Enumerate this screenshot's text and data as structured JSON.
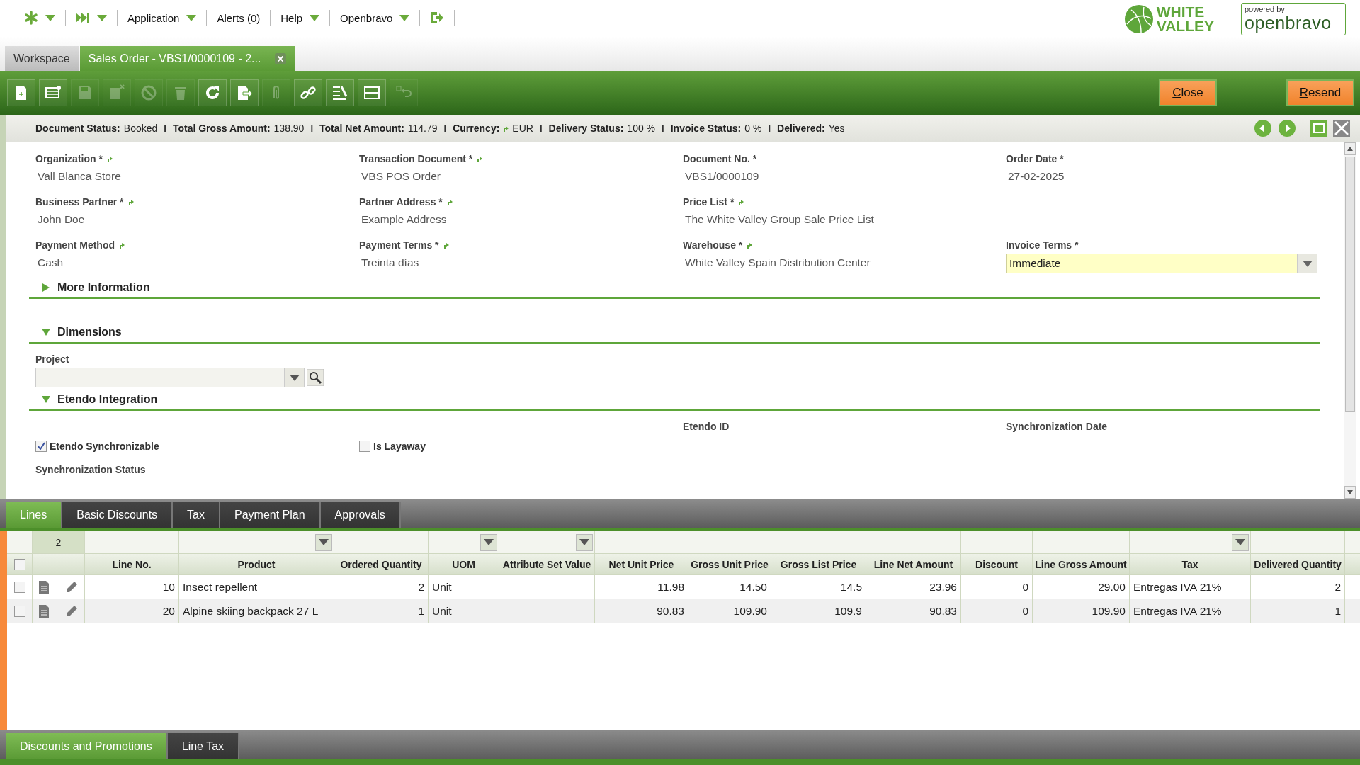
{
  "top_menu": {
    "items": [
      {
        "kind": "star",
        "dropdown": true
      },
      {
        "kind": "forward",
        "dropdown": true
      },
      {
        "kind": "text",
        "label": "Application",
        "dropdown": true
      },
      {
        "kind": "text",
        "label": "Alerts (0)",
        "dropdown": false
      },
      {
        "kind": "text",
        "label": "Help",
        "dropdown": true
      },
      {
        "kind": "text",
        "label": "Openbravo",
        "dropdown": true
      },
      {
        "kind": "logout",
        "dropdown": false
      }
    ],
    "logos": {
      "company": [
        "WHITE",
        "VALLEY"
      ],
      "powered_by": "powered by",
      "product": "openbravo"
    }
  },
  "window_tabs": [
    {
      "label": "Workspace",
      "selected": false,
      "closable": false
    },
    {
      "label": "Sales Order - VBS1/0000109 - 2...",
      "selected": true,
      "closable": true
    }
  ],
  "toolbar": {
    "buttons": [
      {
        "kind": "new",
        "disabled": false
      },
      {
        "kind": "new-grid",
        "disabled": false
      },
      {
        "kind": "save",
        "disabled": true
      },
      {
        "kind": "save-close",
        "disabled": true
      },
      {
        "kind": "cancel",
        "disabled": true
      },
      {
        "kind": "delete",
        "disabled": true
      },
      {
        "kind": "refresh",
        "disabled": false
      },
      {
        "kind": "export",
        "disabled": false
      },
      {
        "kind": "attach",
        "disabled": true
      },
      {
        "kind": "link",
        "disabled": false
      },
      {
        "kind": "tools",
        "disabled": false
      },
      {
        "kind": "layout",
        "disabled": false
      },
      {
        "kind": "undo",
        "disabled": true
      }
    ],
    "actions": [
      "Close",
      "Resend"
    ]
  },
  "status_bar": [
    {
      "label": "Document Status:",
      "value": "Booked",
      "link": false
    },
    {
      "separator": "I",
      "label": "Total Gross Amount:",
      "value": "138.90",
      "link": false
    },
    {
      "separator": "I",
      "label": "Total Net Amount:",
      "value": "114.79",
      "link": false
    },
    {
      "separator": "I",
      "label": "Currency:",
      "value": "EUR",
      "link": true
    },
    {
      "separator": "I",
      "label": "Delivery Status:",
      "value": "100 %",
      "link": false
    },
    {
      "separator": "I",
      "label": "Invoice Status:",
      "value": "0 %",
      "link": false
    },
    {
      "separator": "I",
      "label": "Delivered:",
      "value": "Yes",
      "link": false
    }
  ],
  "form": {
    "rows": [
      [
        {
          "kind": "text",
          "label": "Organization *",
          "value": "Vall Blanca Store",
          "link": true
        },
        {
          "kind": "text",
          "label": "Transaction Document *",
          "value": "VBS POS Order",
          "link": true
        },
        {
          "kind": "text",
          "label": "Document No. *",
          "value": "VBS1/0000109",
          "link": false
        },
        {
          "kind": "text",
          "label": "Order Date *",
          "value": "27-02-2025",
          "link": false
        }
      ],
      [
        {
          "kind": "text",
          "label": "Business Partner *",
          "value": "John Doe",
          "link": true
        },
        {
          "kind": "text",
          "label": "Partner Address *",
          "value": "Example Address",
          "link": true
        },
        {
          "kind": "text",
          "label": "Price List *",
          "value": "The White Valley Group Sale Price List",
          "link": true
        }
      ],
      [
        {
          "kind": "text",
          "label": "Payment Method",
          "value": "Cash",
          "link": true
        },
        {
          "kind": "text",
          "label": "Payment Terms *",
          "value": "Treinta días",
          "link": true
        },
        {
          "kind": "text",
          "label": "Warehouse *",
          "value": "White Valley Spain Distribution Center",
          "link": true
        },
        {
          "kind": "select",
          "label": "Invoice Terms *",
          "value": "Immediate",
          "link": false
        }
      ]
    ],
    "sections": [
      {
        "title": "More Information",
        "expanded": false
      },
      {
        "title": "Dimensions",
        "expanded": true,
        "rows": [
          [
            {
              "kind": "search",
              "label": "Project",
              "link": false
            }
          ]
        ]
      },
      {
        "title": "Etendo Integration",
        "expanded": true,
        "rows": [
          [
            {
              "kind": "checkbox",
              "label": "Etendo Synchronizable",
              "checked": true
            },
            {
              "kind": "checkbox",
              "label": "Is Layaway",
              "checked": false
            },
            {
              "kind": "text",
              "label": "Etendo ID",
              "link": false
            },
            {
              "kind": "text",
              "label": "Synchronization Date",
              "link": false
            }
          ],
          [
            {
              "kind": "text",
              "label": "Synchronization Status",
              "link": false
            }
          ]
        ]
      }
    ]
  },
  "sub_tabs": [
    {
      "label": "Lines",
      "selected": true
    },
    {
      "label": "Basic Discounts",
      "selected": false
    },
    {
      "label": "Tax",
      "selected": false
    },
    {
      "label": "Payment Plan",
      "selected": false
    },
    {
      "label": "Approvals",
      "selected": false
    }
  ],
  "grid": {
    "row_count": "2",
    "select_all_checked": false,
    "columns": [
      {
        "label": "Line No.",
        "filter_dropdown": false
      },
      {
        "label": "Product",
        "filter_dropdown": true
      },
      {
        "label": "Ordered Quantity",
        "filter_dropdown": false
      },
      {
        "label": "UOM",
        "filter_dropdown": true
      },
      {
        "label": "Attribute Set Value",
        "filter_dropdown": true
      },
      {
        "label": "Net Unit Price",
        "filter_dropdown": false
      },
      {
        "label": "Gross Unit Price",
        "filter_dropdown": false
      },
      {
        "label": "Gross List Price",
        "filter_dropdown": false
      },
      {
        "label": "Line Net Amount",
        "filter_dropdown": false
      },
      {
        "label": "Discount",
        "filter_dropdown": false
      },
      {
        "label": "Line Gross Amount",
        "filter_dropdown": false
      },
      {
        "label": "Tax",
        "filter_dropdown": true
      },
      {
        "label": "Delivered Quantity",
        "filter_dropdown": false
      }
    ],
    "rows": [
      {
        "checked": false,
        "cells": [
          "10",
          "Insect repellent",
          "2",
          "Unit",
          "",
          "11.98",
          "14.50",
          "14.5",
          "23.96",
          "0",
          "29.00",
          "Entregas IVA 21%",
          "2"
        ]
      },
      {
        "checked": false,
        "cells": [
          "20",
          "Alpine skiing backpack 27 L",
          "1",
          "Unit",
          "",
          "90.83",
          "109.90",
          "109.9",
          "90.83",
          "0",
          "109.90",
          "Entregas IVA 21%",
          "1"
        ]
      }
    ]
  },
  "bottom_tabs": [
    {
      "label": "Discounts and Promotions",
      "selected": true
    },
    {
      "label": "Line Tax",
      "selected": false
    }
  ]
}
